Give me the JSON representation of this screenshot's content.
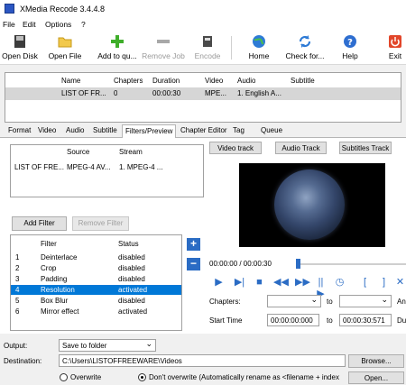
{
  "window": {
    "title": "XMedia Recode 3.4.4.8"
  },
  "menu": [
    "File",
    "Edit",
    "Options",
    "?"
  ],
  "toolbar": {
    "open_disk": "Open Disk",
    "open_file": "Open File",
    "add_to_queue": "Add to qu...",
    "remove_job": "Remove Job",
    "encode": "Encode",
    "home": "Home",
    "check_for": "Check for...",
    "help": "Help",
    "exit": "Exit"
  },
  "jobs": {
    "headers": [
      "Name",
      "Chapters",
      "Duration",
      "Video",
      "Audio",
      "Subtitle"
    ],
    "row": [
      "LIST OF FR...",
      "0",
      "00:00:30",
      "MPE...",
      "1. English A...",
      ""
    ]
  },
  "tabs": [
    "Format",
    "Video",
    "Audio",
    "Subtitle",
    "Filters/Preview",
    "Chapter Editor",
    "Tag",
    "Queue"
  ],
  "active_tab": "Filters/Preview",
  "streams": {
    "headers": [
      "Source",
      "Stream"
    ],
    "row": [
      "LIST OF FRE...",
      "MPEG-4 AV...",
      "1. MPEG-4 ..."
    ]
  },
  "buttons": {
    "add_filter": "Add Filter",
    "remove_filter": "Remove Filter",
    "video_track": "Video track",
    "audio_track": "Audio Track",
    "subtitles_track": "Subtitles Track",
    "browse": "Browse...",
    "open": "Open..."
  },
  "filters": {
    "headers": [
      "Filter",
      "Status"
    ],
    "rows": [
      [
        "1",
        "Deinterlace",
        "disabled"
      ],
      [
        "2",
        "Crop",
        "disabled"
      ],
      [
        "3",
        "Padding",
        "disabled"
      ],
      [
        "4",
        "Resolution",
        "activated"
      ],
      [
        "5",
        "Box Blur",
        "disabled"
      ],
      [
        "6",
        "Mirror effect",
        "activated"
      ]
    ]
  },
  "preview": {
    "time": "00:00:00 / 00:00:30",
    "chapters_label": "Chapters:",
    "to_label_1": "to",
    "an_label": "An",
    "start_time_label": "Start Time",
    "start_time": "00:00:00:000",
    "to_label_2": "to",
    "end_time": "00:00:30:571",
    "du_label": "Du"
  },
  "output": {
    "label": "Output:",
    "value": "Save to folder",
    "destination_label": "Destination:",
    "destination": "C:\\Users\\LISTOFFREEWARE\\Videos",
    "overwrite": "Overwrite",
    "dont_overwrite": "Don't overwrite (Automatically rename as <filename + index"
  }
}
